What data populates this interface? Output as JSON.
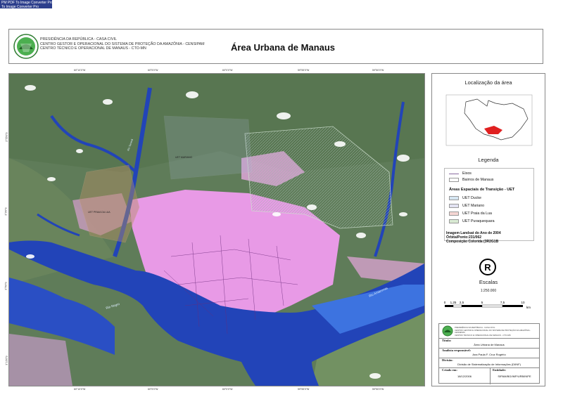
{
  "watermark": {
    "line1": "PM PDF To Image Converter Pro",
    "line2": "To Image Converter Pro"
  },
  "header": {
    "institution": [
      "PRESIDÊNCIA DA REPÚBLICA - CASA CIVIL",
      "CENTRO GESTOR E OPERACIONAL DO SISTEMA DE PROTEÇÃO DA AMAZÔNIA - CENSIPAM",
      "CENTRO TÉCNICO E OPERACIONAL DE MANAUS - CTO-MN"
    ],
    "title": "Área Urbana de Manaus"
  },
  "map": {
    "top_ticks": [
      "60°10'0\"W",
      "60°5'0\"W",
      "60°0'0\"W",
      "59°55'0\"W",
      "59°50'0\"W"
    ],
    "left_ticks": [
      "2°55'0\"S",
      "3°0'0\"S",
      "3°5'0\"S",
      "3°10'0\"S"
    ],
    "labels": {
      "rio_negro": "Rio Negro",
      "rio_amazonas": "Rio Amazonas",
      "uet_praia_da_lua": "UET PRAIA DA LUA",
      "uet_tarumã": "UET MARIANO",
      "rio_tarumã": "Rio Tarumã"
    },
    "colors": {
      "water": "#2244b8",
      "forest": "#5c7a55",
      "urban": "#e89ae6"
    }
  },
  "sidebar": {
    "location_title": "Localização da área",
    "legend_title": "Legenda",
    "legend_items": [
      {
        "label": "Eixos",
        "color": "#8a6aa0"
      },
      {
        "label": "Bairros de Manaus",
        "color": "#ffffff"
      }
    ],
    "uet_heading": "Áreas Espaciais de Transição - UET",
    "uet_items": [
      {
        "label": "UET Ducke",
        "color": "#d6e6f2"
      },
      {
        "label": "UET Mariano",
        "color": "#e3e3f2"
      },
      {
        "label": "UET Praia da Lua",
        "color": "#f5d6d3"
      },
      {
        "label": "UET Puraquequara",
        "color": "#d9ead3"
      }
    ],
    "image_info": [
      "Imagem Landsat do Ano de 2004",
      "Órbita/Ponto:231/062",
      "Composição Colorida (3R2G1B"
    ],
    "north_symbol": "R",
    "scale_title": "Escalas",
    "scale_ratio": "1:250.000",
    "scale_ticks": [
      "0",
      "1,25",
      "2,5",
      "5",
      "7,5",
      "10"
    ],
    "scale_unit": "km",
    "footer": {
      "title_label": "Título:",
      "title_value": "Área Urbana de Manaus",
      "analyst_label": "Analista responsável:",
      "analyst_value": "Ana Paula F. Cruz Rogério",
      "division_label": "Divisão:",
      "division_value": "Divisão de Sistematização de Informações (DIINF)",
      "created_label": "Criado em:",
      "created_value": "18/12/2006",
      "file_label": "Entidade:",
      "file_value": "SIPAM/BG/IMP/URB/INPE"
    }
  }
}
